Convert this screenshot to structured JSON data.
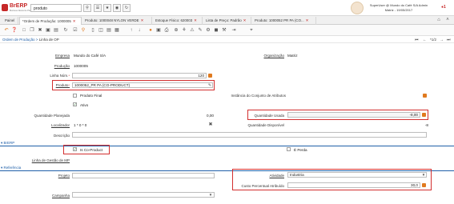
{
  "app": {
    "logo_text": "BrERP",
    "logo_sub": "Business Resource Planning",
    "search_value": "produto",
    "user_line1": "SuperUser @ Mundo do Café S/A Admin",
    "user_line2": "Matriz - 19/05/2017",
    "alert_count": "1"
  },
  "tabs": [
    {
      "label": "Painel"
    },
    {
      "label": "*Ordem de Produção: 1000005"
    },
    {
      "label": "Produto: 1000048 NYLON VERDE"
    },
    {
      "label": "Estoque Físico: 620003"
    },
    {
      "label": "Lista de Preço: Padrão"
    },
    {
      "label": "Produto: 1000052 PR PA (CO..."
    }
  ],
  "breadcrumb": {
    "parent": "Ordem de Produção",
    "separator": ">",
    "current": "Linha de OP",
    "record_pos": "*1/2"
  },
  "form": {
    "empresa_label": "Empresa",
    "empresa_value": "Mundo do Café S/A",
    "organizacao_label": "Organização",
    "organizacao_value": "Matriz",
    "producao_label": "Produção",
    "producao_value": "1000005",
    "linha_label": "Linha Núm.",
    "linha_value": "120",
    "produto_label": "Produto",
    "produto_value": "1000052_PR PA (CO-PRODUCT)",
    "produto_final_label": "Produto Final",
    "instancia_label": "Instância do Conjunto de Atributos",
    "ativo_label": "Ativo",
    "qtd_planejada_label": "Quantidade Planejada",
    "qtd_planejada_value": "0,00",
    "qtd_usada_label": "Quantidade Usada",
    "qtd_usada_value": "-8,00",
    "localizador_label": "Localizador",
    "localizador_value": "1 * 0 * 0",
    "qtd_disponivel_label": "Quantidade Disponível",
    "qtd_disponivel_value": "-8",
    "descricao_label": "Descrição",
    "brerp_section": "BrERP",
    "is_coproduct_label": "Is Co-Product",
    "e_perda_label": "É Perda",
    "linha_gestao_label": "Linha de Gestão de MP",
    "referencia_section": "Referência",
    "projeto_label": "Projeto",
    "atividade_label": "Atividade",
    "atividade_value": "Industria",
    "custo_label": "Custo Percentual Atribuído",
    "custo_value": "30,0",
    "campanha_label": "Campanha"
  },
  "colors": {
    "brand_red": "#c62828",
    "link_blue": "#1f5fa8",
    "accent_orange": "#e07a1f",
    "highlight_border": "#d32f2f"
  }
}
